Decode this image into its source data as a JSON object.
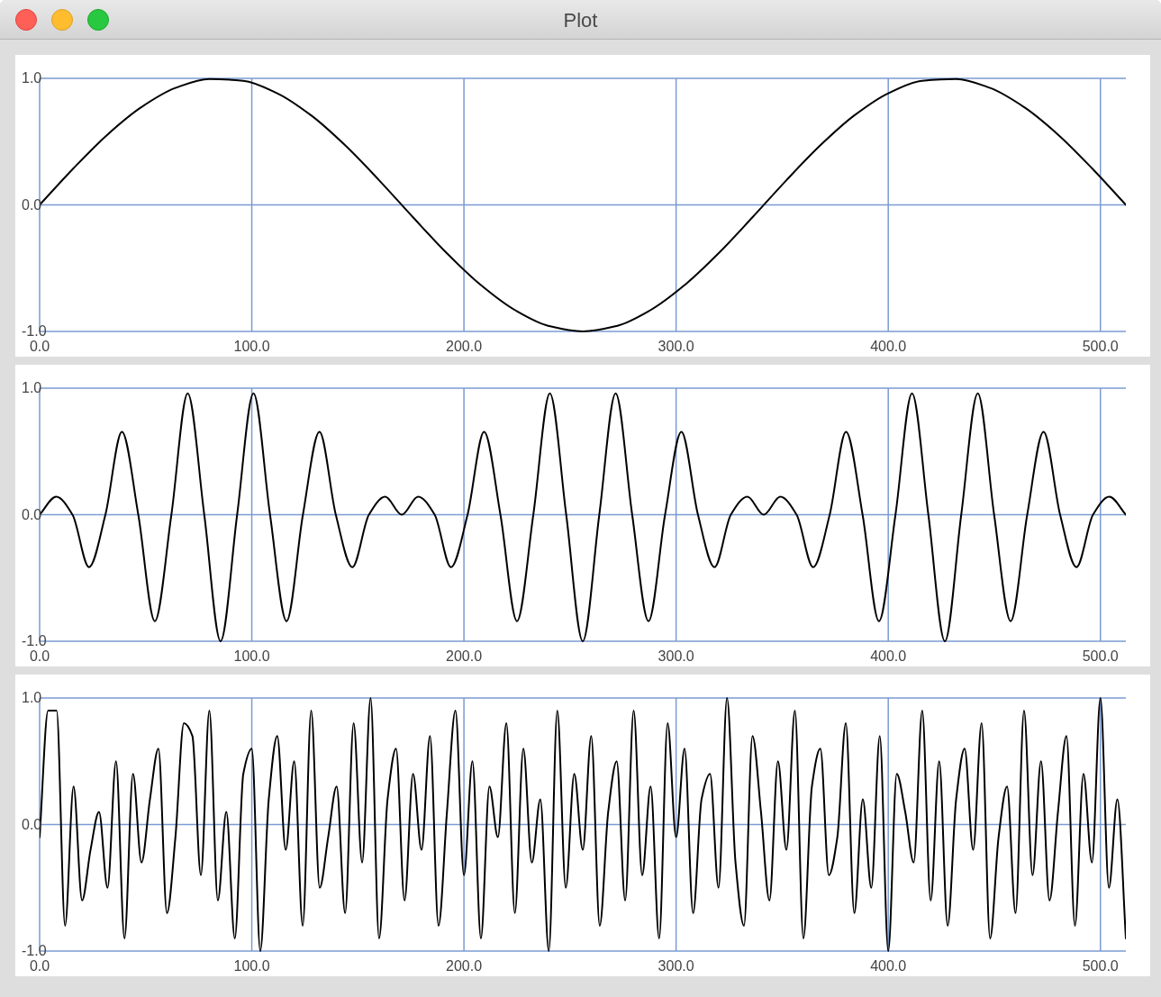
{
  "window": {
    "title": "Plot"
  },
  "plots": [
    {
      "chart_data": {
        "type": "line",
        "grid": true,
        "xlim": [
          0,
          512
        ],
        "ylim": [
          -1,
          1
        ],
        "xticks": [
          {
            "value": 0,
            "label": "0.0"
          },
          {
            "value": 100,
            "label": "100.0"
          },
          {
            "value": 200,
            "label": "200.0"
          },
          {
            "value": 300,
            "label": "300.0"
          },
          {
            "value": 400,
            "label": "400.0"
          },
          {
            "value": 500,
            "label": "500.0"
          }
        ],
        "yticks": [
          {
            "value": -1,
            "label": "-1.0"
          },
          {
            "value": 0,
            "label": "0.0"
          },
          {
            "value": 1,
            "label": "1.0"
          }
        ],
        "x": [
          0,
          16,
          32,
          48,
          64,
          80,
          96,
          112,
          128,
          144,
          160,
          176,
          192,
          208,
          224,
          240,
          256,
          272,
          288,
          304,
          320,
          336,
          352,
          368,
          384,
          400,
          416,
          432,
          448,
          464,
          480,
          496,
          512
        ],
        "series": [
          {
            "color": "#000000",
            "values": [
              0,
              0.29,
              0.556,
              0.773,
              0.924,
              0.995,
              0.981,
              0.882,
              0.707,
              0.471,
              0.195,
              -0.098,
              -0.383,
              -0.634,
              -0.831,
              -0.957,
              -1,
              -0.957,
              -0.831,
              -0.634,
              -0.383,
              -0.098,
              0.195,
              0.471,
              0.707,
              0.882,
              0.981,
              0.995,
              0.924,
              0.773,
              0.556,
              0.29,
              0
            ]
          }
        ]
      }
    },
    {
      "chart_data": {
        "type": "line",
        "grid": true,
        "xlim": [
          0,
          512
        ],
        "ylim": [
          -1,
          1
        ],
        "xticks": [
          {
            "value": 0,
            "label": "0.0"
          },
          {
            "value": 100,
            "label": "100.0"
          },
          {
            "value": 200,
            "label": "200.0"
          },
          {
            "value": 300,
            "label": "300.0"
          },
          {
            "value": 400,
            "label": "400.0"
          },
          {
            "value": 500,
            "label": "500.0"
          }
        ],
        "yticks": [
          {
            "value": -1,
            "label": "-1.0"
          },
          {
            "value": 0,
            "label": "0.0"
          },
          {
            "value": 1,
            "label": "1.0"
          }
        ],
        "x": [
          0,
          7.8,
          15.5,
          23.3,
          31.0,
          38.8,
          46.5,
          54.3,
          62.1,
          69.8,
          77.6,
          85.3,
          93.1,
          100.8,
          108.6,
          116.4,
          124.1,
          131.9,
          139.6,
          147.4,
          155.2,
          162.9,
          170.7,
          178.4,
          186.2,
          193.9,
          201.7,
          209.5,
          217.2,
          225.0,
          232.7,
          240.5,
          248.2,
          256.0,
          263.8,
          271.5,
          279.3,
          287.0,
          294.8,
          302.5,
          310.3,
          318.1,
          325.8,
          333.6,
          341.3,
          349.1,
          356.8,
          364.6,
          372.4,
          380.1,
          387.9,
          395.6,
          403.4,
          411.2,
          418.9,
          426.7,
          434.4,
          442.2,
          449.9,
          457.7,
          465.5,
          473.2,
          481.0,
          488.7,
          496.5,
          504.2,
          512.0
        ],
        "series": [
          {
            "color": "#000000",
            "values": [
              0,
              0.142,
              0,
              -0.415,
              0,
              0.655,
              0,
              -0.841,
              0,
              0.959,
              0,
              -1,
              0,
              0.959,
              0,
              -0.841,
              0,
              0.655,
              0,
              -0.415,
              0,
              0.142,
              0,
              0.142,
              0,
              -0.415,
              0,
              0.655,
              0,
              -0.841,
              0,
              0.959,
              0,
              -1,
              0,
              0.959,
              0,
              -0.841,
              0,
              0.655,
              0,
              -0.415,
              0,
              0.142,
              0,
              0.142,
              0,
              -0.415,
              0,
              0.655,
              0,
              -0.841,
              0,
              0.959,
              0,
              -1,
              0,
              0.959,
              0,
              -0.841,
              0,
              0.655,
              0,
              -0.415,
              0,
              0.142,
              0
            ]
          }
        ]
      }
    },
    {
      "chart_data": {
        "type": "line",
        "grid": true,
        "xlim": [
          0,
          512
        ],
        "ylim": [
          -1,
          1
        ],
        "xticks": [
          {
            "value": 0,
            "label": "0.0"
          },
          {
            "value": 100,
            "label": "100.0"
          },
          {
            "value": 200,
            "label": "200.0"
          },
          {
            "value": 300,
            "label": "300.0"
          },
          {
            "value": 400,
            "label": "400.0"
          },
          {
            "value": 500,
            "label": "500.0"
          }
        ],
        "yticks": [
          {
            "value": -1,
            "label": "-1.0"
          },
          {
            "value": 0,
            "label": "0.0"
          },
          {
            "value": 1,
            "label": "1.0"
          }
        ],
        "x": [
          0,
          4,
          8,
          12,
          16,
          20,
          24,
          28,
          32,
          36,
          40,
          44,
          48,
          52,
          56,
          60,
          64,
          68,
          72,
          76,
          80,
          84,
          88,
          92,
          96,
          100,
          104,
          108,
          112,
          116,
          120,
          124,
          128,
          132,
          136,
          140,
          144,
          148,
          152,
          156,
          160,
          164,
          168,
          172,
          176,
          180,
          184,
          188,
          192,
          196,
          200,
          204,
          208,
          212,
          216,
          220,
          224,
          228,
          232,
          236,
          240,
          244,
          248,
          252,
          256,
          260,
          264,
          268,
          272,
          276,
          280,
          284,
          288,
          292,
          296,
          300,
          304,
          308,
          312,
          316,
          320,
          324,
          328,
          332,
          336,
          340,
          344,
          348,
          352,
          356,
          360,
          364,
          368,
          372,
          376,
          380,
          384,
          388,
          392,
          396,
          400,
          404,
          408,
          412,
          416,
          420,
          424,
          428,
          432,
          436,
          440,
          444,
          448,
          452,
          456,
          460,
          464,
          468,
          472,
          476,
          480,
          484,
          488,
          492,
          496,
          500,
          504,
          508,
          512
        ],
        "series": [
          {
            "color": "#000000",
            "values": [
              -0.1,
              0.9,
              0.9,
              -0.8,
              0.3,
              -0.6,
              -0.2,
              0.1,
              -0.5,
              0.5,
              -0.9,
              0.4,
              -0.3,
              0.2,
              0.6,
              -0.7,
              -0.1,
              0.8,
              0.7,
              -0.4,
              0.9,
              -0.6,
              0.1,
              -0.9,
              0.4,
              0.6,
              -1,
              0.2,
              0.7,
              -0.2,
              0.5,
              -0.8,
              0.9,
              -0.5,
              -0.1,
              0.3,
              -0.7,
              0.8,
              -0.3,
              1,
              -0.9,
              0.2,
              0.6,
              -0.6,
              0.4,
              -0.2,
              0.7,
              -0.8,
              0.1,
              0.9,
              -0.4,
              0.5,
              -0.9,
              0.3,
              -0.1,
              0.8,
              -0.7,
              0.6,
              -0.3,
              0.2,
              -1,
              0.9,
              -0.5,
              0.4,
              -0.2,
              0.7,
              -0.8,
              0.1,
              0.5,
              -0.6,
              0.9,
              -0.4,
              0.3,
              -0.9,
              0.8,
              -0.1,
              0.6,
              -0.7,
              0.2,
              0.4,
              -0.5,
              1,
              -0.3,
              -0.8,
              0.7,
              0.1,
              -0.6,
              0.5,
              -0.2,
              0.9,
              -0.9,
              0.3,
              0.6,
              -0.4,
              -0.1,
              0.8,
              -0.7,
              0.2,
              -0.5,
              0.7,
              -1,
              0.4,
              0.1,
              -0.3,
              0.9,
              -0.6,
              0.5,
              -0.8,
              0.2,
              0.6,
              -0.2,
              0.8,
              -0.9,
              -0.1,
              0.3,
              -0.7,
              0.9,
              -0.4,
              0.5,
              -0.6,
              0.1,
              0.7,
              -0.8,
              0.4,
              -0.3,
              1,
              -0.5,
              0.2,
              -0.9
            ]
          }
        ]
      }
    }
  ]
}
